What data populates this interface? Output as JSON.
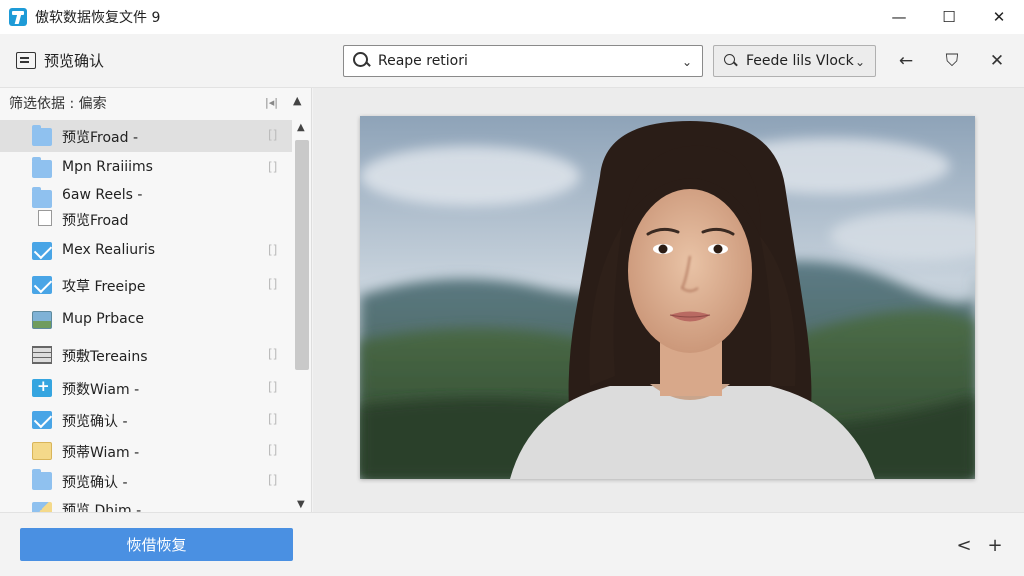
{
  "window": {
    "title": "傲软数据恢复文件 9",
    "minimize_glyph": "—",
    "maximize_glyph": "☐",
    "close_glyph": "✕"
  },
  "toolbar": {
    "preview_label": "预览确认",
    "search": {
      "value": "Reape retiori",
      "chevron": "⌄"
    },
    "filter": {
      "label": "Feede lils Vlock",
      "chevron": "⌄"
    },
    "back_glyph": "←",
    "shield_glyph": "⛉",
    "close_glyph": "✕"
  },
  "sidebar": {
    "header_label": "筛选依据 : 偏索",
    "header_tool_glyph": "|◂|",
    "header_up_glyph": "▲",
    "scroll_up_glyph": "▲",
    "scroll_down_glyph": "▼",
    "items": [
      {
        "label": "预览Froad -",
        "icon": "folder-icon",
        "tag": "[]"
      },
      {
        "label": "Mpn Rraiiims",
        "icon": "folder-icon",
        "tag": "[]"
      },
      {
        "label": "6aw Reels -",
        "icon": "folder-icon",
        "tag": ""
      },
      {
        "label": "预览Froad",
        "icon": "document-icon",
        "tag": ""
      },
      {
        "label": "Mex Realiuris",
        "icon": "mail-icon",
        "tag": "[]"
      },
      {
        "label": "攻草 Freeipe",
        "icon": "mail-icon",
        "tag": "[]"
      },
      {
        "label": "Mup Prbace",
        "icon": "image-icon",
        "tag": ""
      },
      {
        "label": "预敷Tereains",
        "icon": "grid-icon",
        "tag": "[]"
      },
      {
        "label": "预数Wiam -",
        "icon": "box-icon",
        "tag": "[]"
      },
      {
        "label": "预览确认 -",
        "icon": "mail-icon",
        "tag": "[]"
      },
      {
        "label": "预蒂Wiam -",
        "icon": "open-folder-icon",
        "tag": "[]"
      },
      {
        "label": "预览确认 -",
        "icon": "folder-icon",
        "tag": "[]"
      },
      {
        "label": "预览 Dhim -",
        "icon": "multi-folder-icon",
        "tag": ""
      }
    ]
  },
  "preview": {
    "image": "portrait-photo"
  },
  "bottom": {
    "recover_label": "恢借恢复",
    "prev_glyph": "<",
    "add_glyph": "+"
  }
}
